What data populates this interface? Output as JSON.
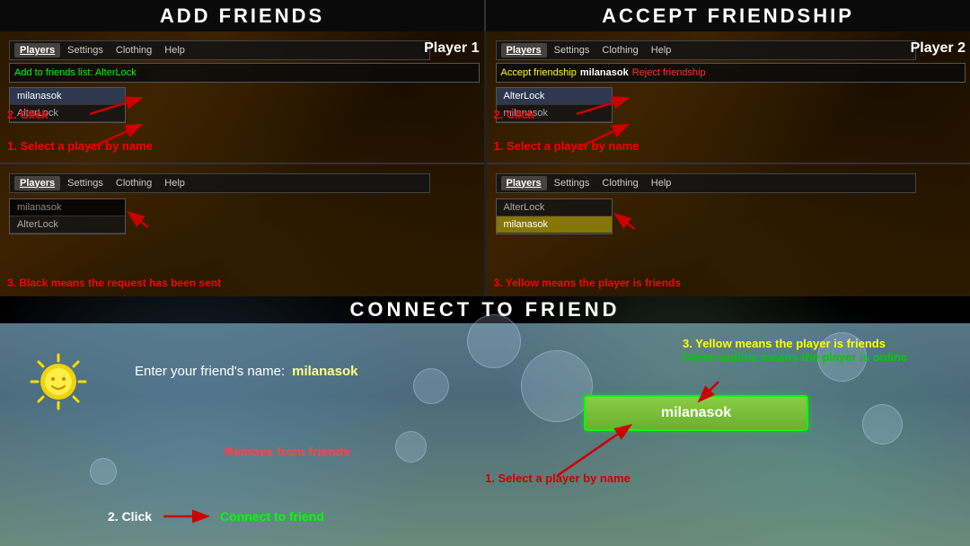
{
  "sections": {
    "add_friends": {
      "title": "ADD  FRIENDS",
      "player_label": "Player 1",
      "menu_items": [
        "Players",
        "Settings",
        "Clothing",
        "Help"
      ],
      "action_text": "Add to friends list: AlterLock",
      "players": [
        "milanasok",
        "AlterLock"
      ],
      "selected_player": "milanasok",
      "step1": "1. Select a player by name",
      "step2": "2. Click",
      "step3": "3. Black means the request has been sent",
      "panel2_players": [
        "milanasok",
        "AlterLock"
      ],
      "panel2_selected": "milanasok"
    },
    "accept_friendship": {
      "title": "ACCEPT  FRIENDSHIP",
      "player_label": "Player 2",
      "menu_items": [
        "Players",
        "Settings",
        "Clothing",
        "Help"
      ],
      "action_accept": "Accept friendship",
      "action_name": "milanasok",
      "action_reject": "Reject friendship",
      "players": [
        "AlterLock",
        "milanasok"
      ],
      "selected_player": "AlterLock",
      "step1": "1. Select a player by name",
      "step2": "2. Click",
      "step3": "3. Yellow means the player is friends",
      "panel2_players": [
        "AlterLock",
        "milanasok"
      ],
      "panel2_yellow": "milanasok"
    },
    "connect_to_friend": {
      "title": "CONNECT  TO  FRIEND",
      "friend_label": "Enter your friend's name:",
      "friend_name": "milanasok",
      "player_name": "milanasok",
      "note3a": "3. Yellow means the player is friends",
      "note3b": "Green outline means the player is online",
      "remove_text": "Remove from friends",
      "step1": "1. Select a player by name",
      "step2_label": "2. Click",
      "connect_link": "Connect to friend"
    }
  }
}
